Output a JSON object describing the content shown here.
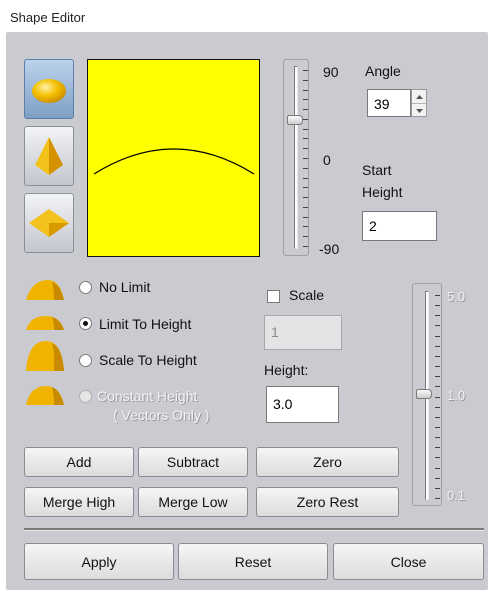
{
  "window": {
    "title": "Shape Editor"
  },
  "shape_buttons": [
    {
      "name": "dome",
      "selected": true
    },
    {
      "name": "pyramid",
      "selected": false
    },
    {
      "name": "diamond",
      "selected": false
    }
  ],
  "angle_slider": {
    "ticks": [
      "90",
      "0",
      "-90"
    ],
    "value": 39
  },
  "angle": {
    "label": "Angle",
    "value": "39"
  },
  "start_height": {
    "label_line1": "Start",
    "label_line2": "Height",
    "value": "2"
  },
  "limit_options": [
    {
      "label": "No Limit",
      "selected": false,
      "enabled": true
    },
    {
      "label": "Limit To Height",
      "selected": true,
      "enabled": true
    },
    {
      "label": "Scale To Height",
      "selected": false,
      "enabled": true
    },
    {
      "label": "Constant Height",
      "sublabel": "( Vectors Only )",
      "selected": false,
      "enabled": false
    }
  ],
  "scale": {
    "label": "Scale",
    "checked": false,
    "value": "1"
  },
  "height": {
    "label": "Height:",
    "value": "3.0"
  },
  "height_slider": {
    "ticks": [
      "5.0",
      "1.0",
      "0.1"
    ]
  },
  "buttons": {
    "add": "Add",
    "subtract": "Subtract",
    "zero": "Zero",
    "merge_high": "Merge High",
    "merge_low": "Merge Low",
    "zero_rest": "Zero Rest"
  },
  "footer": {
    "apply": "Apply",
    "reset": "Reset",
    "close": "Close"
  },
  "colors": {
    "preview_bg": "#ffff00",
    "icon_gold": "#e8a300"
  }
}
